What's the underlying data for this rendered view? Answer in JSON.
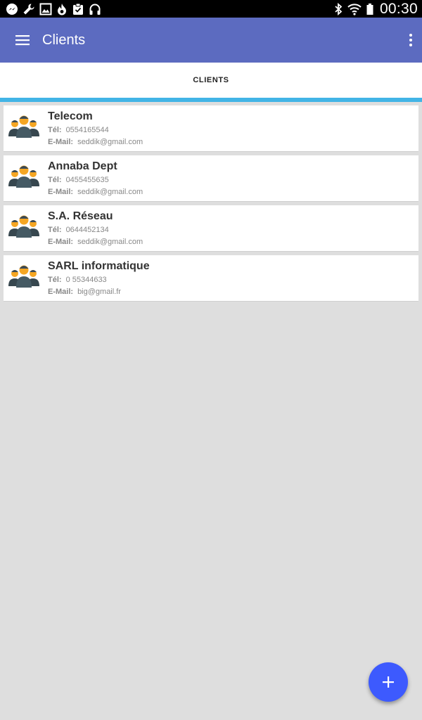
{
  "status_bar": {
    "time": "00:30",
    "left_icons": [
      "messenger-icon",
      "wrench-icon",
      "image-icon",
      "flame-icon",
      "clipboard-icon",
      "headphones-icon"
    ],
    "right_icons": [
      "bluetooth-icon",
      "wifi-icon",
      "battery-icon"
    ]
  },
  "app_bar": {
    "title": "Clients",
    "color": "#5c6bc0"
  },
  "tabs": [
    {
      "label": "CLIENTS",
      "selected": true
    }
  ],
  "clients": [
    {
      "name": "Telecom",
      "tel_label": "Tél:",
      "tel": "0554165544",
      "email_label": "E-Mail:",
      "email": "seddik@gmail.com"
    },
    {
      "name": "Annaba Dept",
      "tel_label": "Tél:",
      "tel": "0455455635",
      "email_label": "E-Mail:",
      "email": "seddik@gmail.com"
    },
    {
      "name": "S.A. Réseau",
      "tel_label": "Tél:",
      "tel": "0644452134",
      "email_label": "E-Mail:",
      "email": "seddik@gmail.com"
    },
    {
      "name": "SARL informatique",
      "tel_label": "Tél:",
      "tel": "0 55344633",
      "email_label": "E-Mail:",
      "email": "big@gmail.fr"
    }
  ],
  "fab": {
    "icon": "plus-icon",
    "color": "#3d5afe"
  },
  "colors": {
    "accent": "#42b4e6",
    "background": "#dedede"
  }
}
